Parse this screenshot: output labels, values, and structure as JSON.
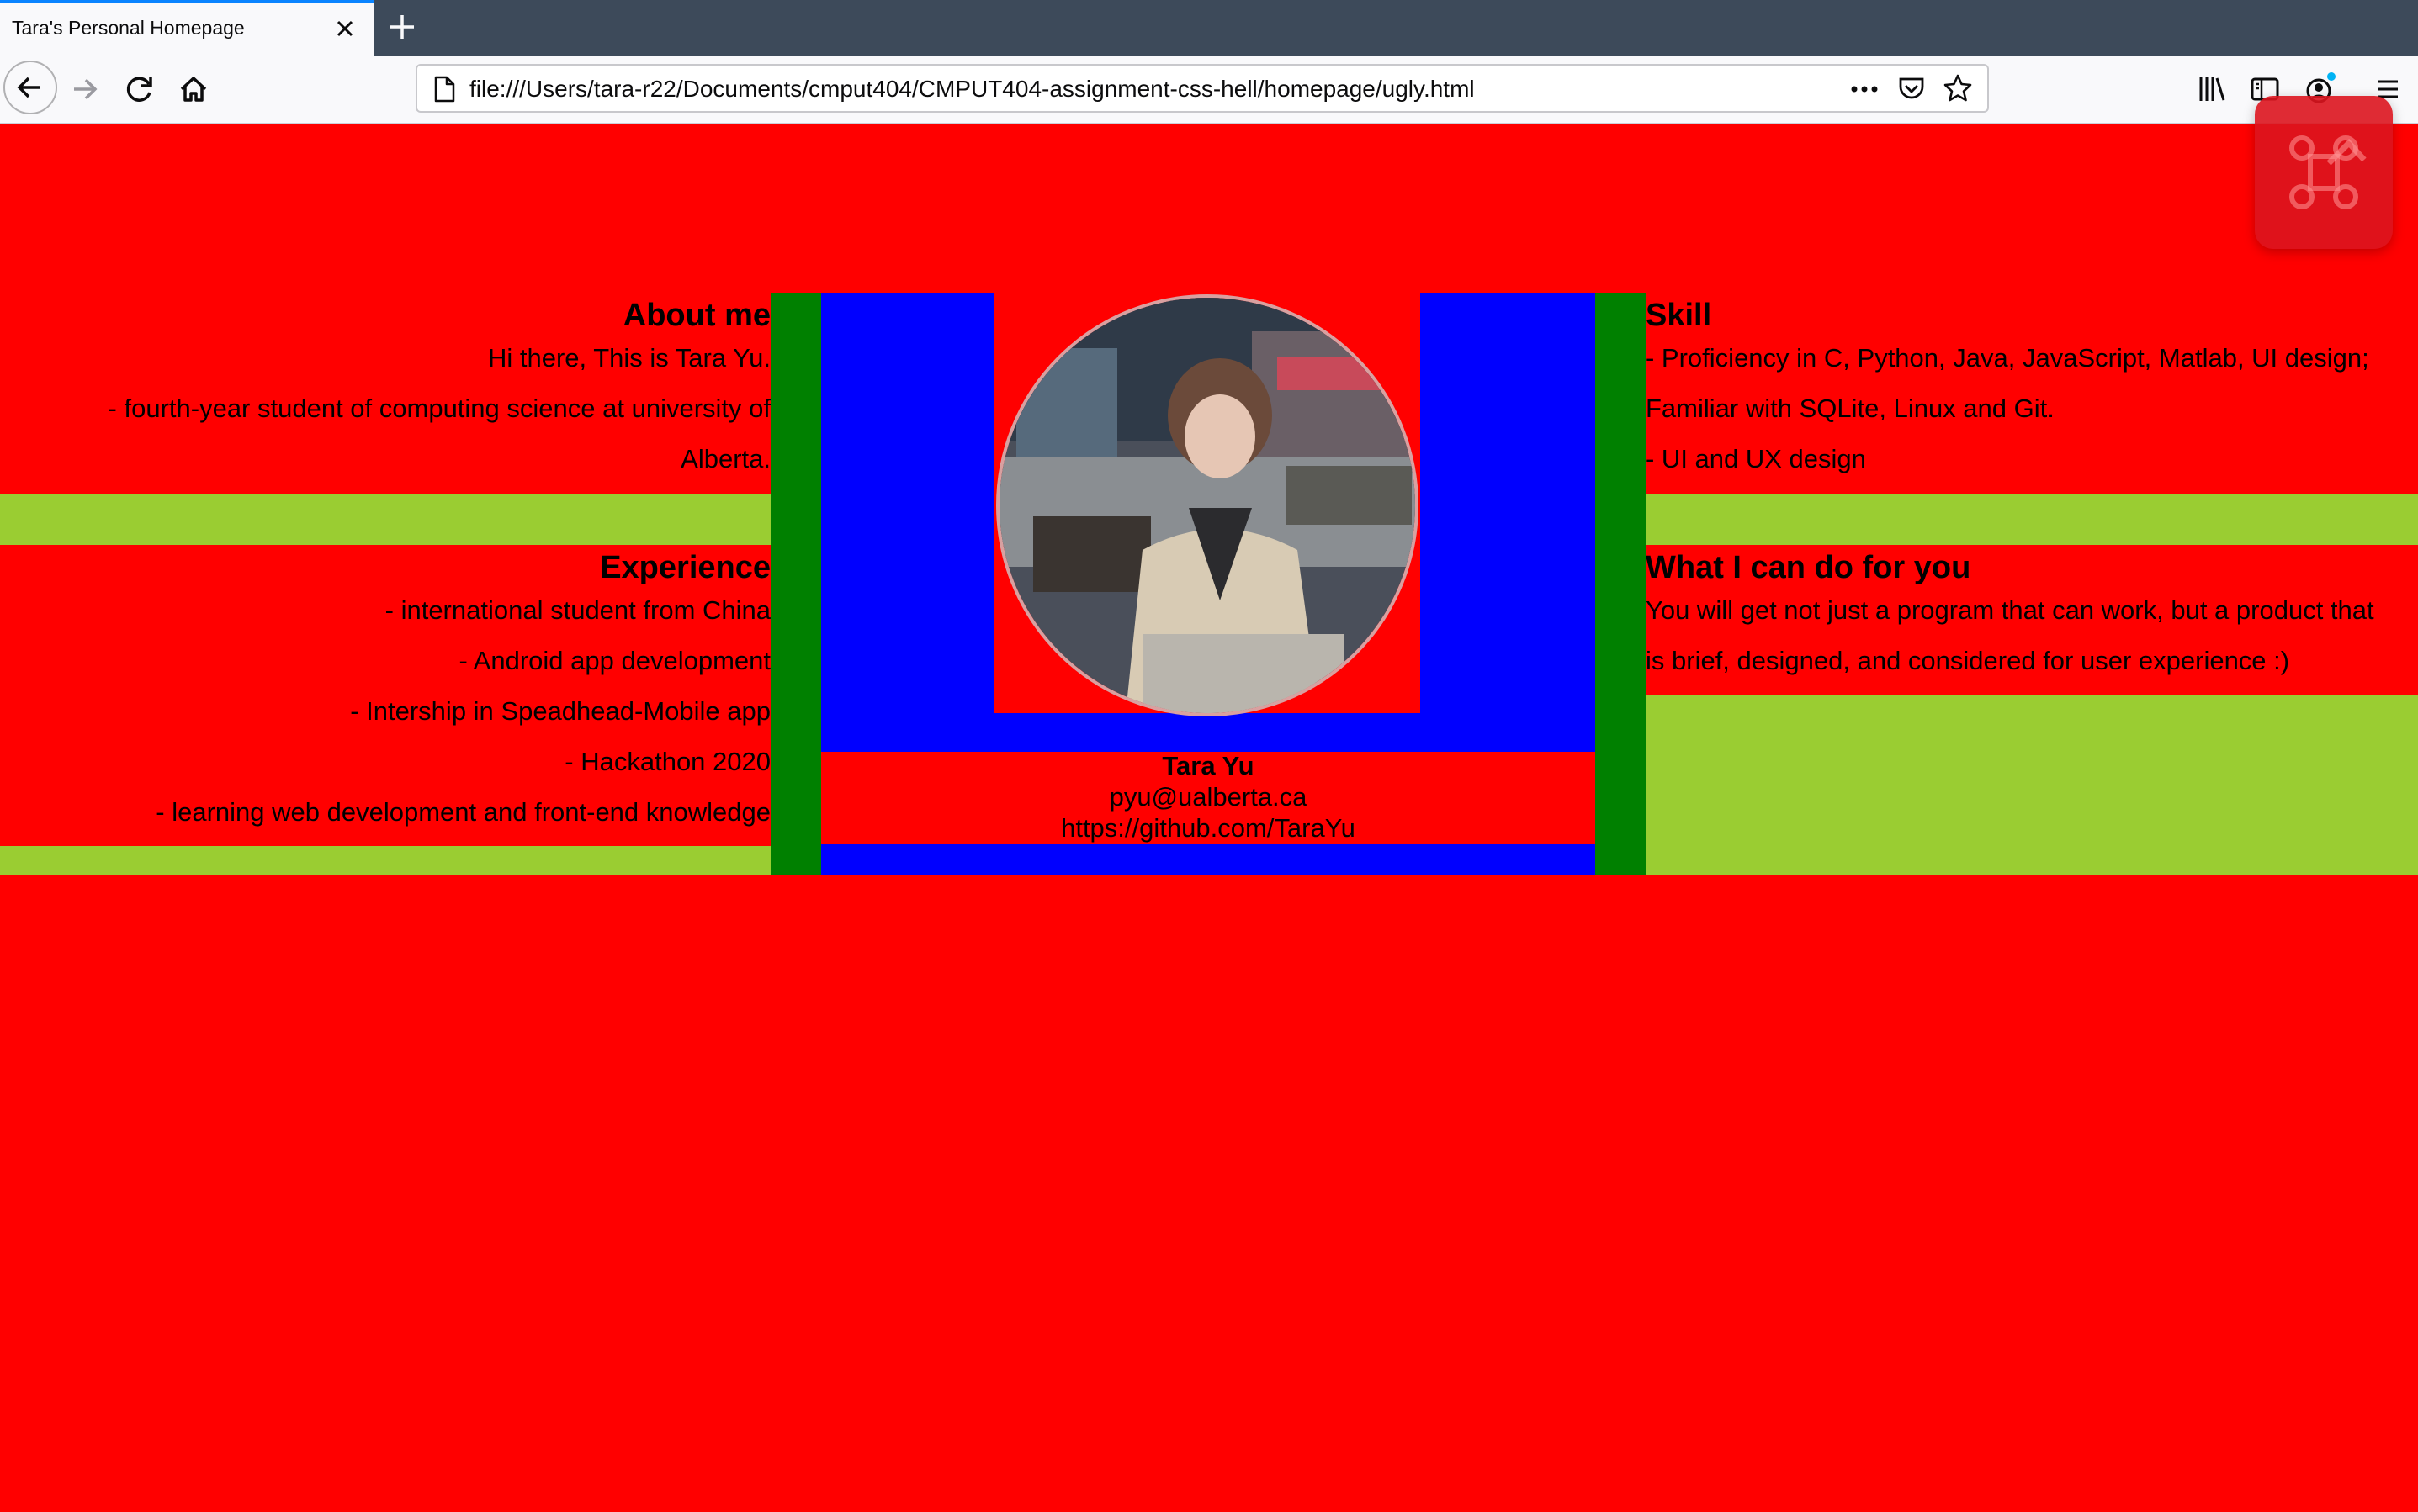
{
  "browser": {
    "tab_title": "Tara's Personal Homepage",
    "url": "file:///Users/tara-r22/Documents/cmput404/CMPUT404-assignment-css-hell/homepage/ugly.html",
    "icons": [
      "back-arrow-icon",
      "forward-arrow-icon",
      "reload-icon",
      "home-icon",
      "page-icon",
      "more-icon",
      "pocket-icon",
      "bookmark-star-icon",
      "library-icon",
      "sidebar-icon",
      "account-icon",
      "menu-icon",
      "close-icon",
      "plus-icon"
    ]
  },
  "colors": {
    "page_bg": "#ff0000",
    "accent_green": "#9acd32",
    "column_green": "#008000",
    "blue": "#0000ff"
  },
  "about": {
    "title": "About me",
    "lines": [
      "Hi there, This is Tara Yu.",
      "- fourth-year student of computing science at university of",
      "Alberta."
    ]
  },
  "experience": {
    "title": "Experience",
    "lines": [
      "- international student from China",
      "- Android app development",
      "- Intership in Speadhead-Mobile app",
      "- Hackathon 2020",
      "- learning web development and front-end knowledge"
    ]
  },
  "skill": {
    "title": "Skill",
    "lines": [
      "- Proficiency in C, Python, Java, JavaScript, Matlab, UI design;",
      "Familiar with SQLite, Linux and Git.",
      "- UI and UX design"
    ]
  },
  "offer": {
    "title": "What I can do for you",
    "lines": [
      "You will get not just a program that can work, but a product that",
      "is brief, designed, and considered for user experience :)"
    ]
  },
  "profile": {
    "name": "Tara Yu",
    "email": "pyu@ualberta.ca",
    "github": "https://github.com/TaraYu"
  }
}
